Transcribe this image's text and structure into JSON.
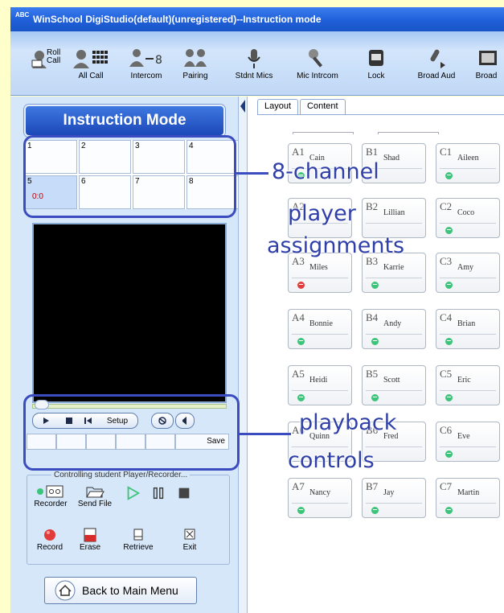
{
  "window": {
    "title": "WinSchool DigiStudio(default)(unregistered)--Instruction mode",
    "icon_text": "ABC"
  },
  "toolbar": {
    "items": [
      {
        "label": "Roll Call",
        "icon": "roll-call-icon"
      },
      {
        "label": "All Call",
        "icon": "all-call-icon"
      },
      {
        "label": "Intercom",
        "icon": "intercom-icon"
      },
      {
        "label": "Pairing",
        "icon": "pairing-icon"
      },
      {
        "label": "Stdnt Mics",
        "icon": "microphone-icon"
      },
      {
        "label": "Mic Intrcom",
        "icon": "mic-intercom-icon"
      },
      {
        "label": "Lock",
        "icon": "lock-icon"
      },
      {
        "label": "Broad Aud",
        "icon": "broadcast-audio-icon"
      },
      {
        "label": "Broad",
        "icon": "broadcast-icon"
      }
    ]
  },
  "left": {
    "mode_title": "Instruction Mode",
    "channels": [
      {
        "num": "1",
        "time": ""
      },
      {
        "num": "2",
        "time": ""
      },
      {
        "num": "3",
        "time": ""
      },
      {
        "num": "4",
        "time": ""
      },
      {
        "num": "5",
        "time": "0:0"
      },
      {
        "num": "6",
        "time": ""
      },
      {
        "num": "7",
        "time": ""
      },
      {
        "num": "8",
        "time": ""
      }
    ],
    "setup_label": "Setup",
    "save_label": "Save",
    "control_group_title": "Controlling student Player/Recorder...",
    "controls": [
      {
        "label": "Recorder",
        "icon": "recorder-icon"
      },
      {
        "label": "Send File",
        "icon": "folder-open-icon"
      },
      {
        "label": "",
        "icon": "play-icon"
      },
      {
        "label": "",
        "icon": "pause-icon"
      },
      {
        "label": "",
        "icon": "stop-icon"
      },
      {
        "label": "Record",
        "icon": "record-icon"
      },
      {
        "label": "Erase",
        "icon": "erase-icon"
      },
      {
        "label": "Retrieve",
        "icon": "retrieve-icon"
      },
      {
        "label": "Exit",
        "icon": "exit-icon"
      }
    ],
    "back_label": "Back to Main Menu"
  },
  "right": {
    "tabs": [
      {
        "label": "Layout",
        "active": true
      },
      {
        "label": "Content",
        "active": false
      }
    ],
    "seats": [
      {
        "id": "A1",
        "name": "Cain",
        "status": "green"
      },
      {
        "id": "B1",
        "name": "Shad",
        "status": ""
      },
      {
        "id": "C1",
        "name": "Aileen",
        "status": "green"
      },
      {
        "id": "A2",
        "name": "",
        "status": ""
      },
      {
        "id": "B2",
        "name": "Lillian",
        "status": ""
      },
      {
        "id": "C2",
        "name": "Coco",
        "status": "green"
      },
      {
        "id": "A3",
        "name": "Miles",
        "status": "red"
      },
      {
        "id": "B3",
        "name": "Karrie",
        "status": "green"
      },
      {
        "id": "C3",
        "name": "Amy",
        "status": "green"
      },
      {
        "id": "A4",
        "name": "Bonnie",
        "status": "green"
      },
      {
        "id": "B4",
        "name": "Andy",
        "status": "green"
      },
      {
        "id": "C4",
        "name": "Brian",
        "status": "green"
      },
      {
        "id": "A5",
        "name": "Heidi",
        "status": "green"
      },
      {
        "id": "B5",
        "name": "Scott",
        "status": "green"
      },
      {
        "id": "C5",
        "name": "Eric",
        "status": "green"
      },
      {
        "id": "A6",
        "name": "Quinn",
        "status": ""
      },
      {
        "id": "B6",
        "name": "Fred",
        "status": ""
      },
      {
        "id": "C6",
        "name": "Eve",
        "status": "green"
      },
      {
        "id": "A7",
        "name": "Nancy",
        "status": "green"
      },
      {
        "id": "B7",
        "name": "Jay",
        "status": "green"
      },
      {
        "id": "C7",
        "name": "Martin",
        "status": "green"
      }
    ]
  },
  "annotations": {
    "channels_line1": "8-channel",
    "channels_line2": "player",
    "channels_line3": "assignments",
    "playback_line1": "playback",
    "playback_line2": "controls"
  },
  "colors": {
    "annotation": "#3b4cc0",
    "status_green": "#3cc47a",
    "status_red": "#e23b3b",
    "title_bar": "#1f5fd8"
  }
}
